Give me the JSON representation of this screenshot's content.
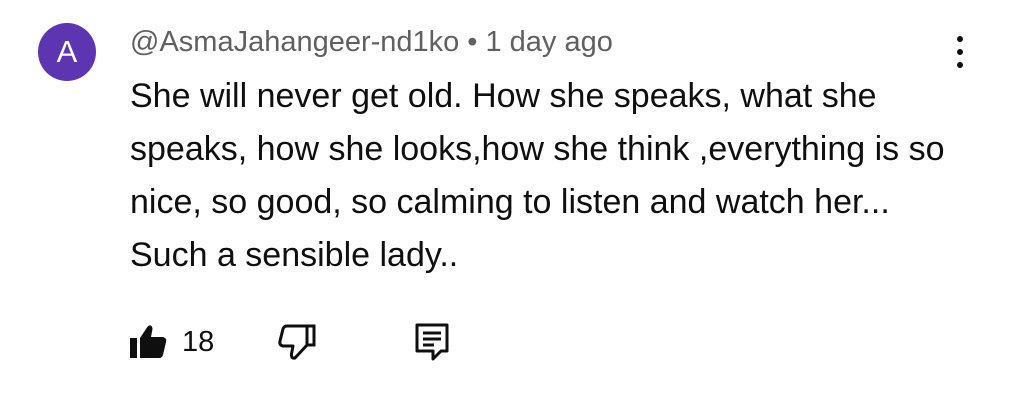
{
  "comment": {
    "avatar_letter": "A",
    "avatar_color": "#5e35b1",
    "author": "@AsmaJahangeer-nd1ko",
    "separator": "•",
    "time": "1 day ago",
    "text": "She will never get old. How she speaks, what she speaks, how she looks,how she think ,everything is so nice, so good, so calming to listen and watch her... Such a sensible lady..",
    "like_count": "18",
    "icons": {
      "like": "thumbs-up-filled-icon",
      "dislike": "thumbs-down-outline-icon",
      "reply": "reply-comment-icon",
      "more": "more-vert-icon"
    }
  }
}
